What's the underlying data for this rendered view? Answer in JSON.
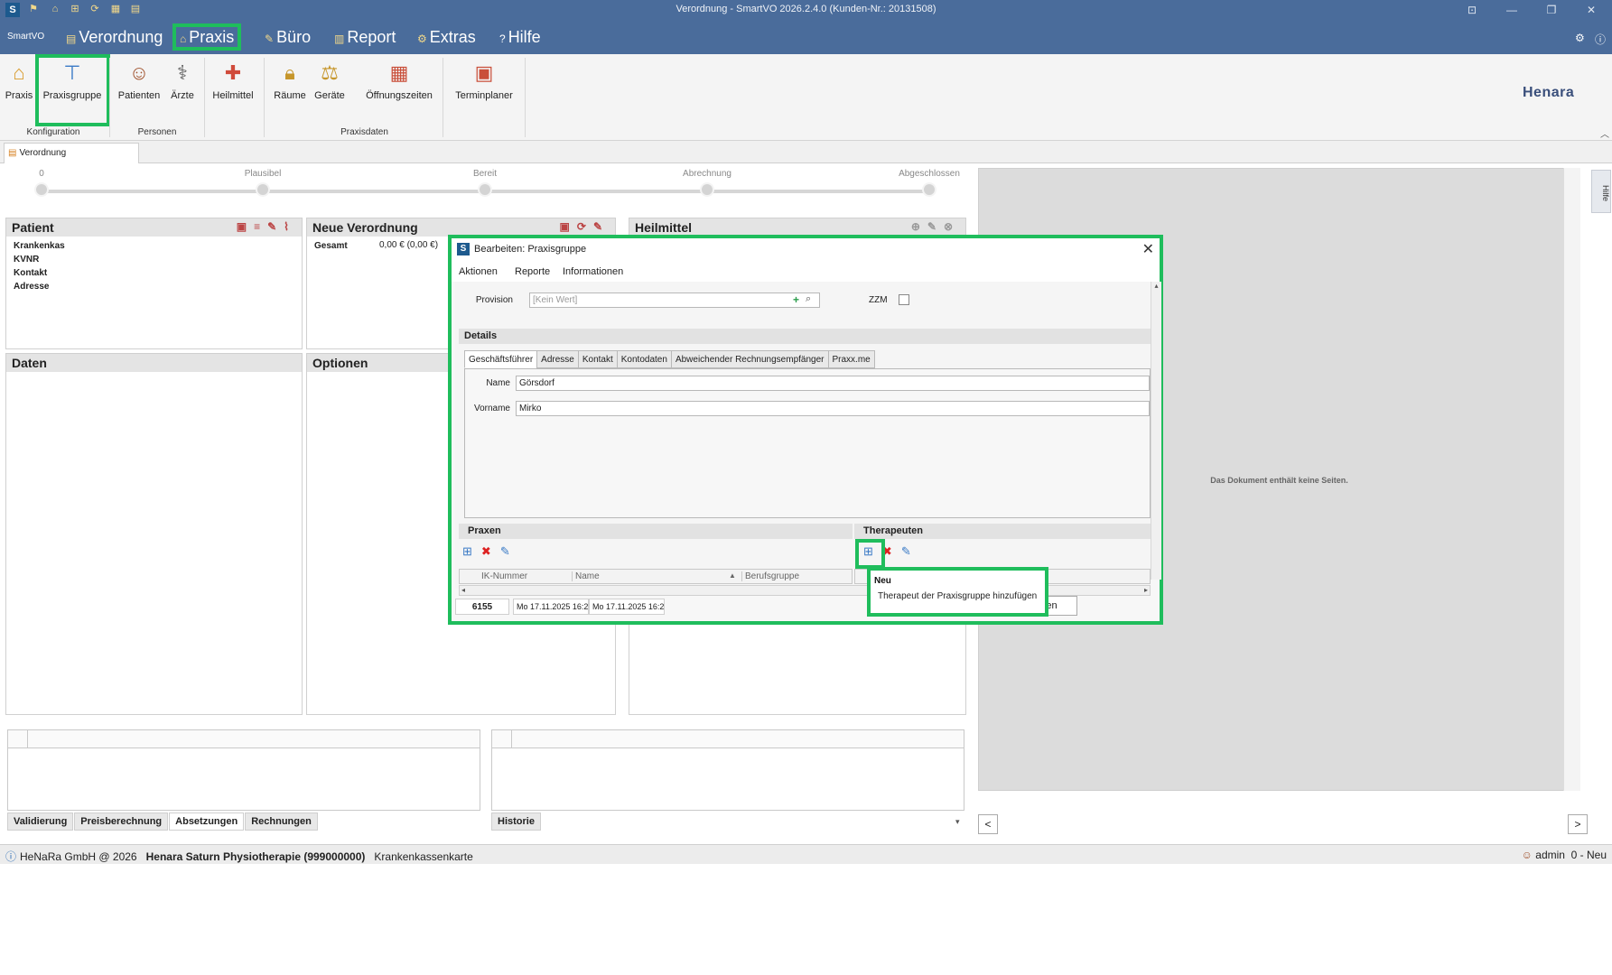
{
  "window": {
    "title": "Verordnung - SmartVO 2026.2.4.0 (Kunden-Nr.: 20131508)",
    "app_logo": "S",
    "quick_access_icons": [
      "flag-icon",
      "home-icon",
      "network-icon",
      "refresh-icon",
      "calendar-icon",
      "document-icon"
    ],
    "controls": [
      "restore-icon",
      "minimize-icon",
      "maximize-icon",
      "close-icon"
    ]
  },
  "menu": {
    "app_label": "SmartVO",
    "tabs": [
      {
        "label": "Verordnung",
        "icon": "document-icon"
      },
      {
        "label": "Praxis",
        "icon": "home-icon",
        "active": true
      },
      {
        "label": "Büro",
        "icon": "tag-icon"
      },
      {
        "label": "Report",
        "icon": "report-icon"
      },
      {
        "label": "Extras",
        "icon": "tools-icon"
      },
      {
        "label": "Hilfe",
        "icon": "question-icon"
      }
    ]
  },
  "ribbon": {
    "buttons": [
      {
        "label": "Praxis",
        "icon": "house-icon"
      },
      {
        "label": "Praxisgruppe",
        "icon": "org-chart-icon",
        "highlighted": true
      },
      {
        "label": "Patienten",
        "icon": "patient-icon"
      },
      {
        "label": "Ärzte",
        "icon": "doctor-icon"
      },
      {
        "label": "Heilmittel",
        "icon": "medical-kit-icon"
      },
      {
        "label": "Räume",
        "icon": "lock-icon"
      },
      {
        "label": "Geräte",
        "icon": "scale-icon"
      },
      {
        "label": "Öffnungszeiten",
        "icon": "calendar-grid-icon"
      },
      {
        "label": "Terminplaner",
        "icon": "calendar-day-icon"
      }
    ],
    "groups": [
      "Konfiguration",
      "Personen",
      "Praxisdaten"
    ],
    "brand": "Henara"
  },
  "doc_tab": {
    "label": "Verordnung"
  },
  "workflow": {
    "steps": [
      "0",
      "Plausibel",
      "Bereit",
      "Abrechnung",
      "Abgeschlossen"
    ]
  },
  "panels": {
    "patient": {
      "title": "Patient",
      "labels": [
        "Krankenkas",
        "KVNR",
        "Kontakt",
        "Adresse"
      ]
    },
    "verordnung": {
      "title": "Neue Verordnung",
      "gesamt_label": "Gesamt",
      "gesamt_value": "0,00 € (0,00 €)"
    },
    "heilmittel": {
      "title": "Heilmittel"
    },
    "daten": {
      "title": "Daten"
    },
    "optionen": {
      "title": "Optionen"
    }
  },
  "bottom_tabs_left": [
    "Validierung",
    "Preisberechnung",
    "Absetzungen",
    "Rechnungen"
  ],
  "bottom_tabs_right": [
    "Historie"
  ],
  "preview": {
    "message": "Das Dokument enthält keine Seiten.",
    "prev": "<",
    "next": ">"
  },
  "side_help": "Hilfe",
  "statusbar": {
    "company": "HeNaRa GmbH @ 2026",
    "practice": "Henara Saturn Physiotherapie (999000000)",
    "card": "Krankenkassenkarte",
    "user": "admin",
    "state": "0 - Neu"
  },
  "dialog": {
    "title": "Bearbeiten: Praxisgruppe",
    "menu": [
      "Aktionen",
      "Reporte",
      "Informationen"
    ],
    "provision_label": "Provision",
    "provision_placeholder": "[Kein Wert]",
    "zzm_label": "ZZM",
    "details_label": "Details",
    "tabs": [
      "Geschäftsführer",
      "Adresse",
      "Kontakt",
      "Kontodaten",
      "Abweichender Rechnungsempfänger",
      "Praxx.me"
    ],
    "name_label": "Name",
    "name_value": "Görsdorf",
    "vorname_label": "Vorname",
    "vorname_value": "Mirko",
    "praxen_label": "Praxen",
    "therapeuten_label": "Therapeuten",
    "praxen_columns": [
      "IK-Nummer",
      "Name",
      "Berufsgruppe"
    ],
    "footer_id": "6155",
    "footer_created": "Mo 17.11.2025 16:2",
    "footer_modified": "Mo 17.11.2025 16:2",
    "cancel_label": "Abbrechen"
  },
  "tooltip": {
    "title": "Neu",
    "description": "Therapeut der Praxisgruppe hinzufügen"
  },
  "colors": {
    "titlebar": "#4a6c9b",
    "highlight": "#1fbd5c",
    "ribbon_bg": "#f4f4f4"
  }
}
